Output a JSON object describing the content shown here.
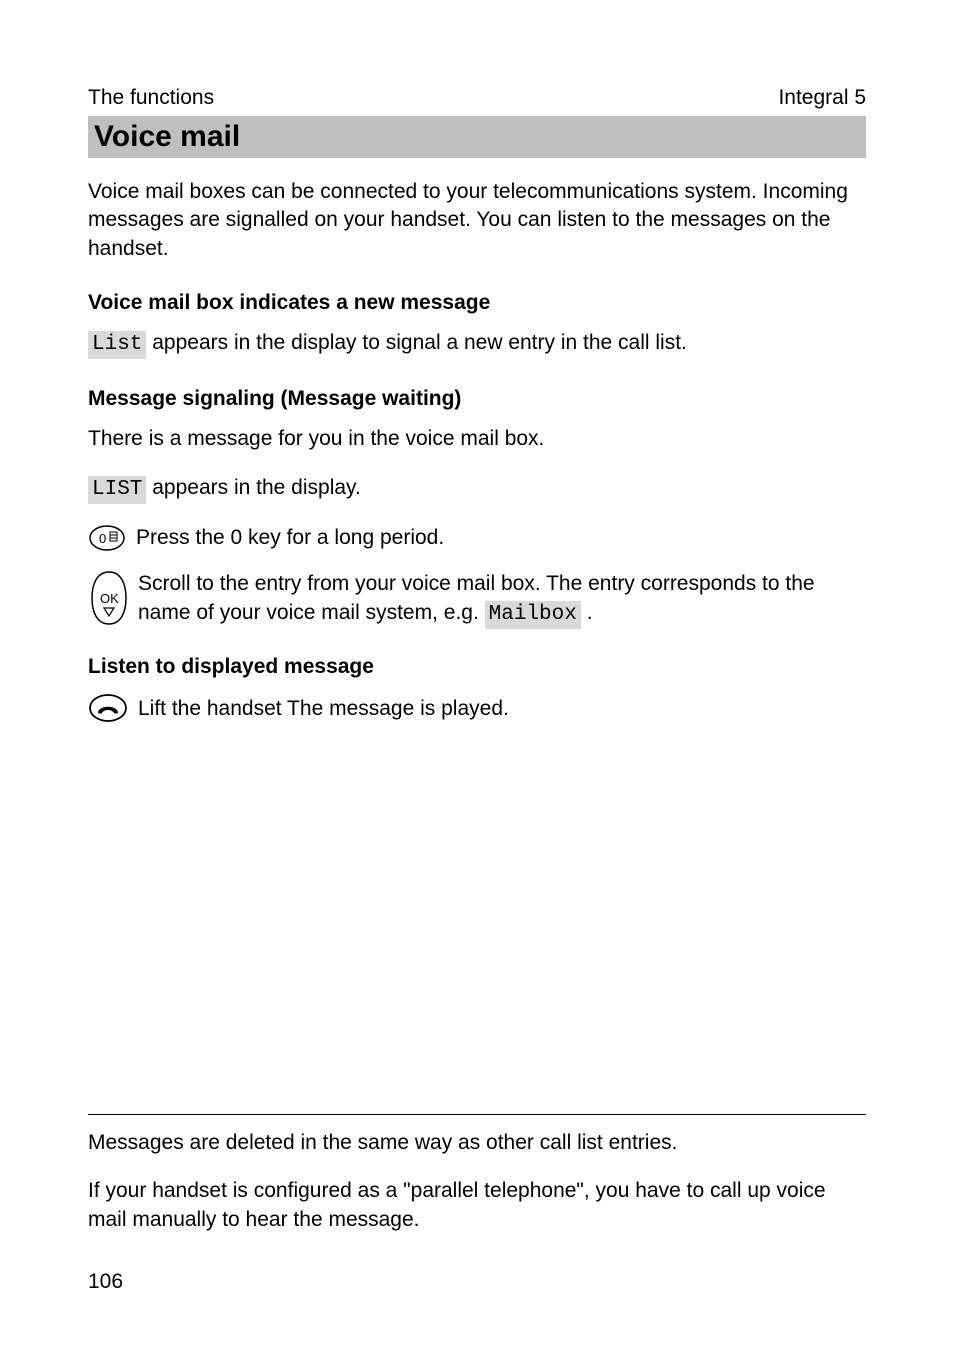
{
  "header": {
    "left": "The functions",
    "right": "Integral 5"
  },
  "title": "Voice mail",
  "intro": "Voice mail boxes can be connected to your telecommunications system. Incoming messages are signalled on your handset. You can listen to the messages on the handset.",
  "sections": {
    "new_msg_head": "Voice mail box indicates a new message",
    "list_code": "List",
    "new_msg_text": " appears in the display to signal a new entry in the call list.",
    "waiting_head": "Message signaling (Message waiting)",
    "waiting_intro": "There is a message for you in the voice mail box.",
    "list_upper_code": "LIST",
    "waiting_text": " appears in the display.",
    "press0": "Press the 0 key for a long period.",
    "scroll_prefix": "Scroll to the entry from your voice mail box. The entry corresponds to the name of your voice mail system, e.g. ",
    "mailbox_code": "Mailbox",
    "scroll_suffix": " .",
    "listen_head": "Listen to displayed message",
    "lift_text": "Lift the handset The message is played."
  },
  "footer": {
    "line1": "Messages are deleted in the same way as other call list entries.",
    "line2": "If your handset is configured as a \"parallel telephone\", you have to call up voice mail manually to hear the message."
  },
  "page_number": "106",
  "icons": {
    "zero_key": "0",
    "ok_label": "OK"
  }
}
